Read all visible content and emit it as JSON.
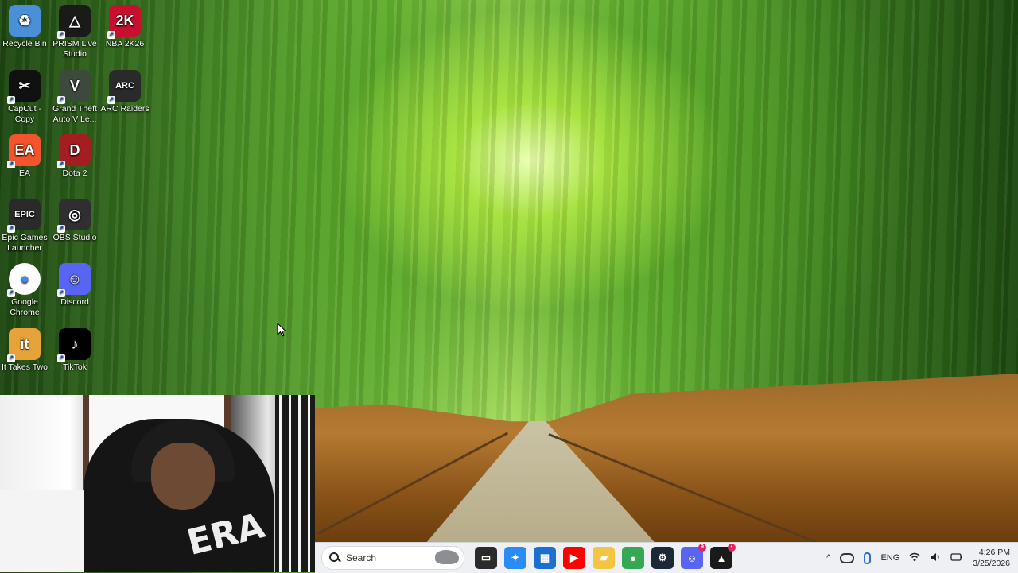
{
  "desktop": {
    "icons": [
      {
        "label": "Recycle Bin",
        "icon": "recycle-bin-icon",
        "color": "#4a90d9",
        "glyph": "♻"
      },
      {
        "label": "PRISM Live Studio",
        "icon": "prism-icon",
        "color": "#1a1a1a",
        "glyph": "△"
      },
      {
        "label": "NBA 2K26",
        "icon": "nba2k26-icon",
        "color": "#c8102e",
        "glyph": "2K"
      },
      {
        "label": "CapCut - Copy",
        "icon": "capcut-icon",
        "color": "#111111",
        "glyph": "✂"
      },
      {
        "label": "Grand Theft Auto V Le...",
        "icon": "gta-icon",
        "color": "#3b4a3a",
        "glyph": "V"
      },
      {
        "label": "ARC Raiders",
        "icon": "arc-raiders-icon",
        "color": "#2a2a2a",
        "glyph": "ARC"
      },
      {
        "label": "EA",
        "icon": "ea-icon",
        "color": "#f2542d",
        "glyph": "EA"
      },
      {
        "label": "Dota 2",
        "icon": "dota2-icon",
        "color": "#a31f1f",
        "glyph": "D"
      },
      {
        "label": "Epic Games Launcher",
        "icon": "epic-games-icon",
        "color": "#2a2a2a",
        "glyph": "EPIC"
      },
      {
        "label": "OBS Studio",
        "icon": "obs-icon",
        "color": "#302e31",
        "glyph": "◎"
      },
      {
        "label": "Google Chrome",
        "icon": "chrome-icon",
        "color": "#ffffff",
        "glyph": "●"
      },
      {
        "label": "Discord",
        "icon": "discord-icon",
        "color": "#5865f2",
        "glyph": "☺"
      },
      {
        "label": "It Takes Two",
        "icon": "it-takes-two-icon",
        "color": "#e8a23a",
        "glyph": "it"
      },
      {
        "label": "TikTok",
        "icon": "tiktok-icon",
        "color": "#000000",
        "glyph": "♪"
      }
    ]
  },
  "webcam": {
    "shirt_text": "ERA"
  },
  "taskbar": {
    "search_placeholder": "Search",
    "apps": [
      {
        "name": "task-view",
        "glyph": "▭",
        "color": "#2b2b2b"
      },
      {
        "name": "copilot",
        "glyph": "✦",
        "color": "#2a8bf2"
      },
      {
        "name": "microsoft-store",
        "glyph": "▦",
        "color": "#1c6fd1"
      },
      {
        "name": "youtube",
        "glyph": "▶",
        "color": "#ff0000"
      },
      {
        "name": "file-explorer",
        "glyph": "▰",
        "color": "#f4c542"
      },
      {
        "name": "chrome",
        "glyph": "●",
        "color": "#34a853"
      },
      {
        "name": "steam",
        "glyph": "⚙",
        "color": "#1b2838"
      },
      {
        "name": "discord",
        "glyph": "☺",
        "color": "#5865f2",
        "badge": "9"
      },
      {
        "name": "adobe-app",
        "glyph": "▲",
        "color": "#1a1a1a",
        "badge": "•"
      }
    ],
    "tray": {
      "chevron": "^",
      "language": "ENG",
      "time": "4:26 PM",
      "date": "3/25/2026"
    }
  }
}
